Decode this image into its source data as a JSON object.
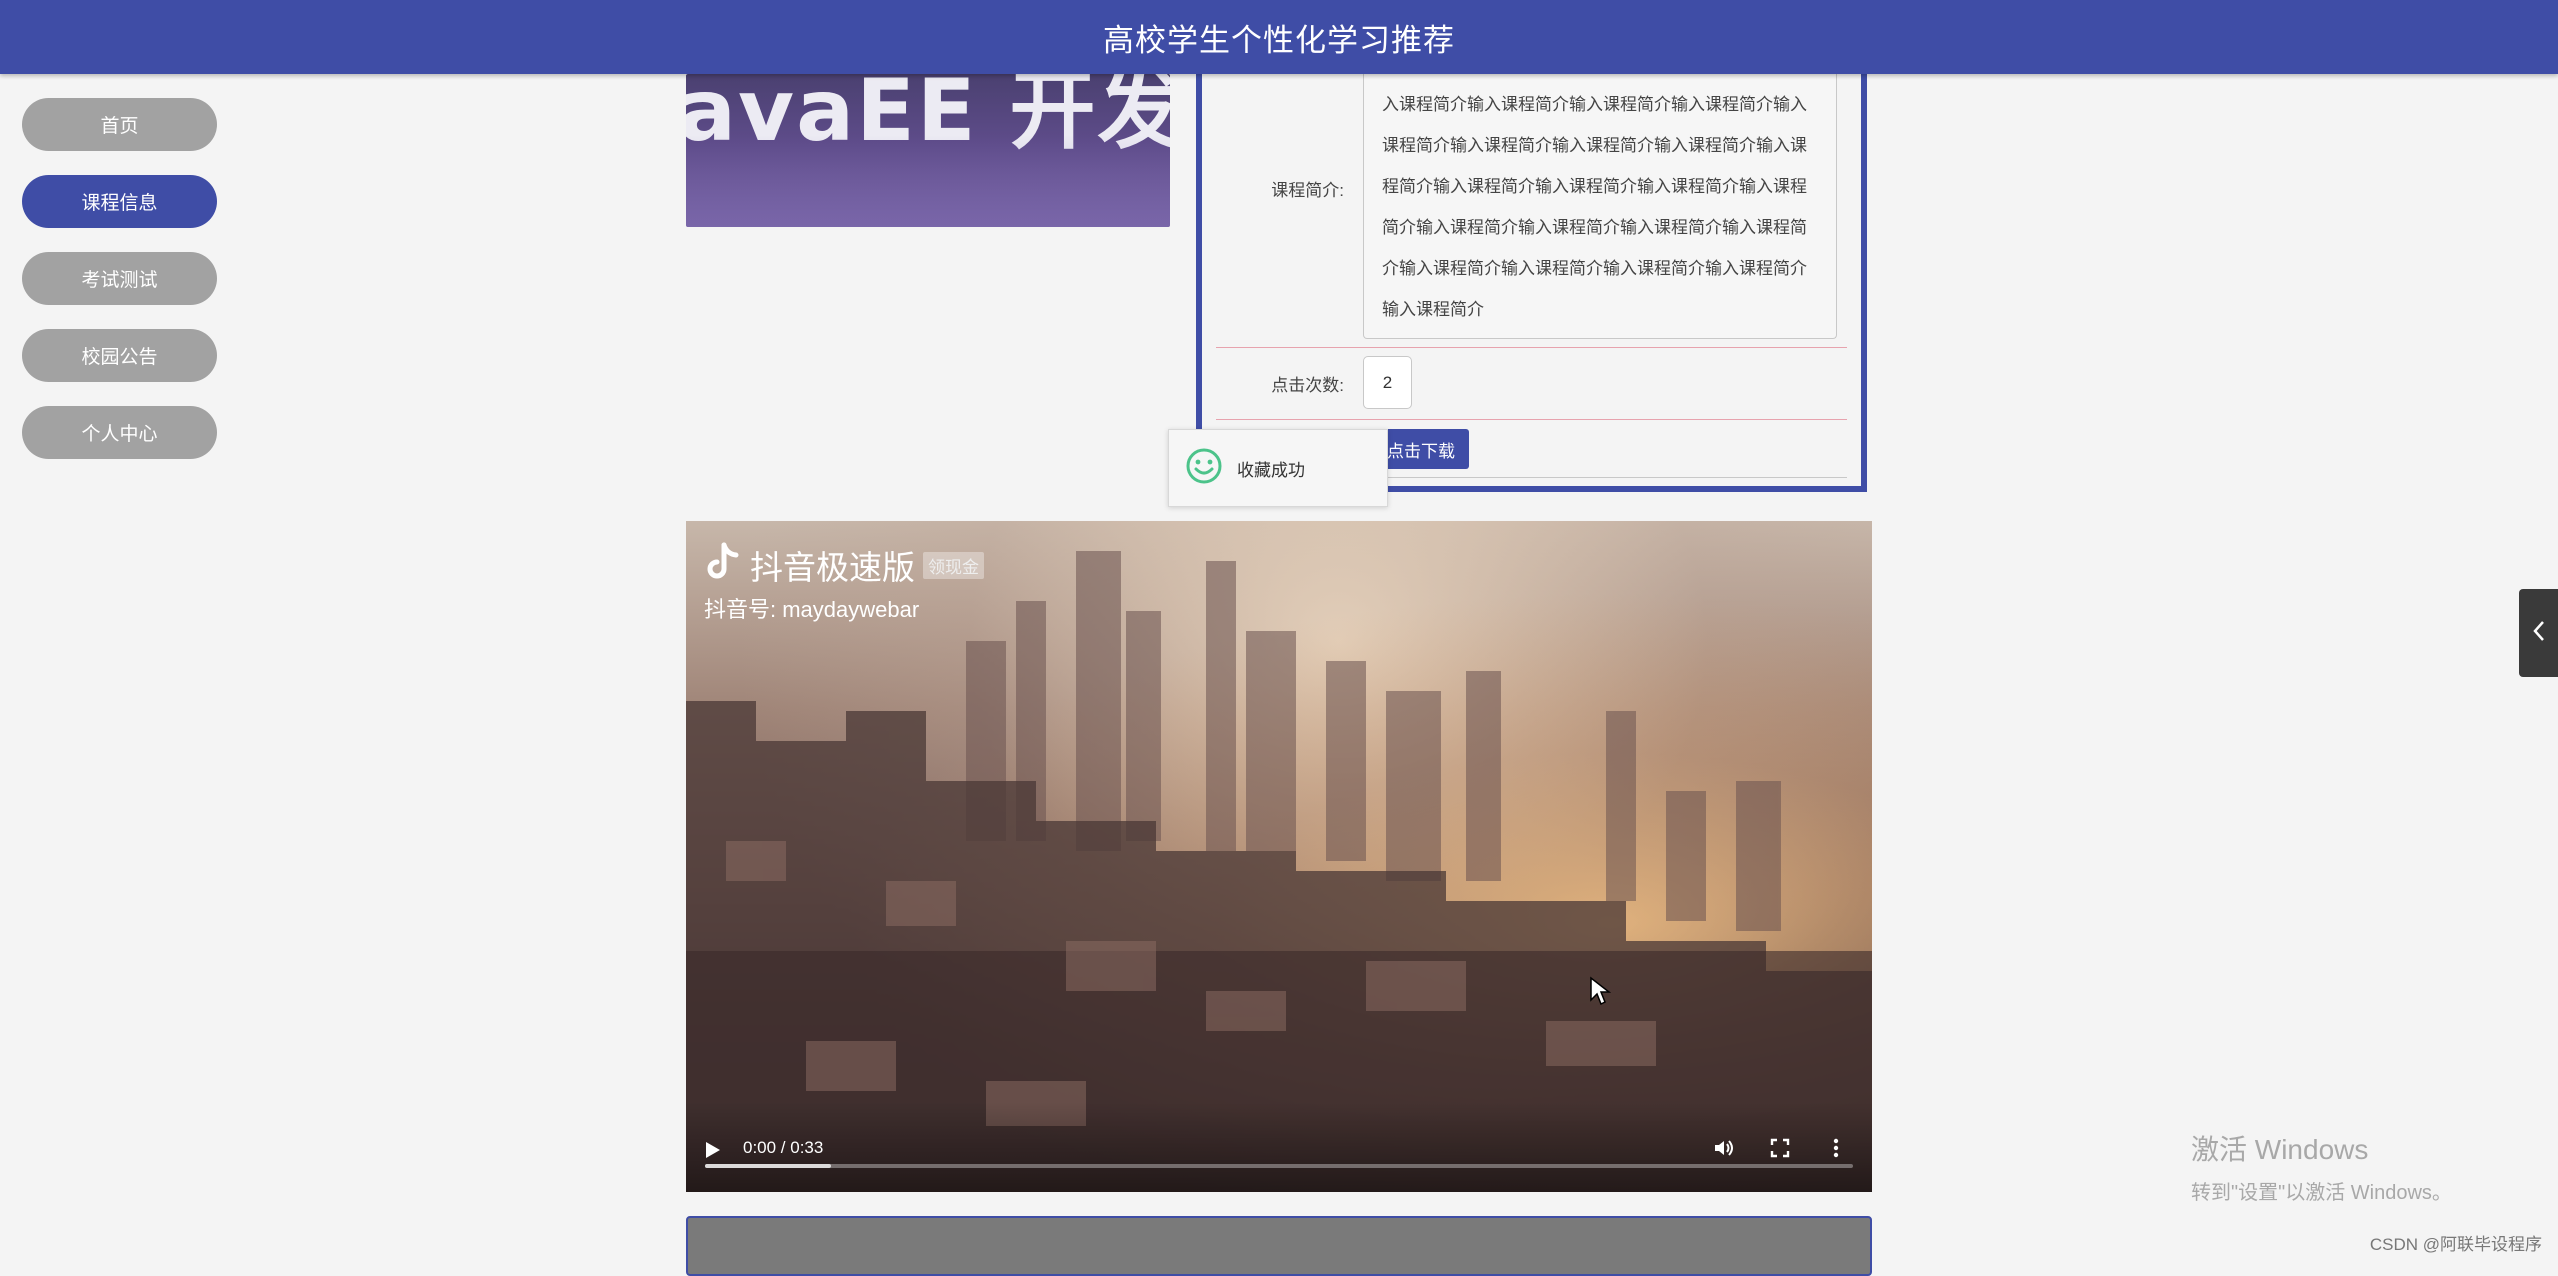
{
  "header": {
    "title": "高校学生个性化学习推荐"
  },
  "sidebar": {
    "items": [
      {
        "label": "首页",
        "active": false
      },
      {
        "label": "课程信息",
        "active": true
      },
      {
        "label": "考试测试",
        "active": false
      },
      {
        "label": "校园公告",
        "active": false
      },
      {
        "label": "个人中心",
        "active": false
      }
    ]
  },
  "course": {
    "cover_text": "avaEE 开发工程",
    "desc_label": "课程简介:",
    "desc_text": "入课程简介输入课程简介输入课程简介输入课程简介输入课程简介输入课程简介输入课程简介输入课程简介输入课程简介输入课程简介输入课程简介输入课程简介输入课程简介输入课程简介输入课程简介输入课程简介输入课程简介输入课程简介输入课程简介输入课程简介输入课程简介输入课程简介",
    "clicks_label": "点击次数:",
    "clicks_value": "2",
    "download_label": "点击下载"
  },
  "toast": {
    "icon": "smiley-icon",
    "message": "收藏成功",
    "color": "#4cc38a"
  },
  "video": {
    "logo_text": "抖音极速版",
    "badge_text": "领现金",
    "handle": "抖音号: maydaywebar",
    "time": "0:00 / 0:33",
    "progress_buffered": 0.11
  },
  "watermark": {
    "title": "激活 Windows",
    "subtitle": "转到\"设置\"以激活 Windows。"
  },
  "footer": {
    "credit": "CSDN @阿联毕设程序"
  },
  "colors": {
    "primary": "#3f4da6",
    "nav_inactive": "#a2a2a2",
    "background": "#f4f4f4"
  }
}
